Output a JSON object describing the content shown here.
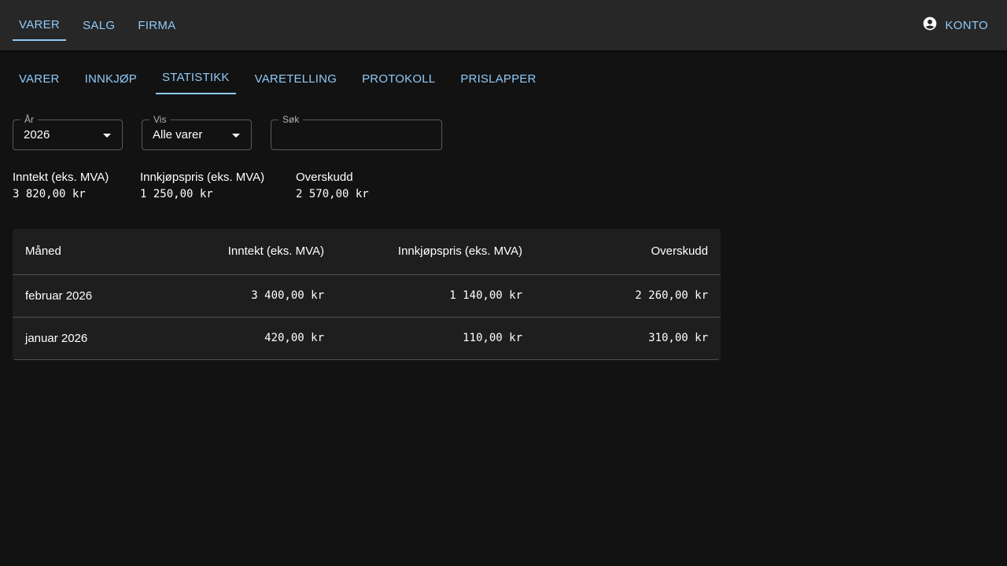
{
  "topnav": {
    "items": [
      {
        "label": "VARER",
        "active": true
      },
      {
        "label": "SALG",
        "active": false
      },
      {
        "label": "FIRMA",
        "active": false
      }
    ],
    "account_label": "KONTO"
  },
  "subtabs": {
    "items": [
      {
        "label": "VARER",
        "active": false
      },
      {
        "label": "INNKJØP",
        "active": false
      },
      {
        "label": "STATISTIKK",
        "active": true
      },
      {
        "label": "VARETELLING",
        "active": false
      },
      {
        "label": "PROTOKOLL",
        "active": false
      },
      {
        "label": "PRISLAPPER",
        "active": false
      }
    ]
  },
  "filters": {
    "year": {
      "label": "År",
      "value": "2026"
    },
    "show": {
      "label": "Vis",
      "value": "Alle varer"
    },
    "search": {
      "label": "Søk",
      "value": ""
    }
  },
  "summary": {
    "income": {
      "label": "Inntekt (eks. MVA)",
      "value": "3 820,00 kr"
    },
    "purchase": {
      "label": "Innkjøpspris (eks. MVA)",
      "value": "1 250,00 kr"
    },
    "surplus": {
      "label": "Overskudd",
      "value": "2 570,00 kr"
    }
  },
  "table": {
    "headers": [
      "Måned",
      "Inntekt (eks. MVA)",
      "Innkjøpspris (eks. MVA)",
      "Overskudd"
    ],
    "rows": [
      [
        "februar 2026",
        "3 400,00 kr",
        "1 140,00 kr",
        "2 260,00 kr"
      ],
      [
        "januar 2026",
        "420,00 kr",
        "110,00 kr",
        "310,00 kr"
      ]
    ]
  },
  "colors": {
    "background": "#121212",
    "appbar": "#272727",
    "accent": "#90caf9",
    "card": "#1e1e1e"
  }
}
